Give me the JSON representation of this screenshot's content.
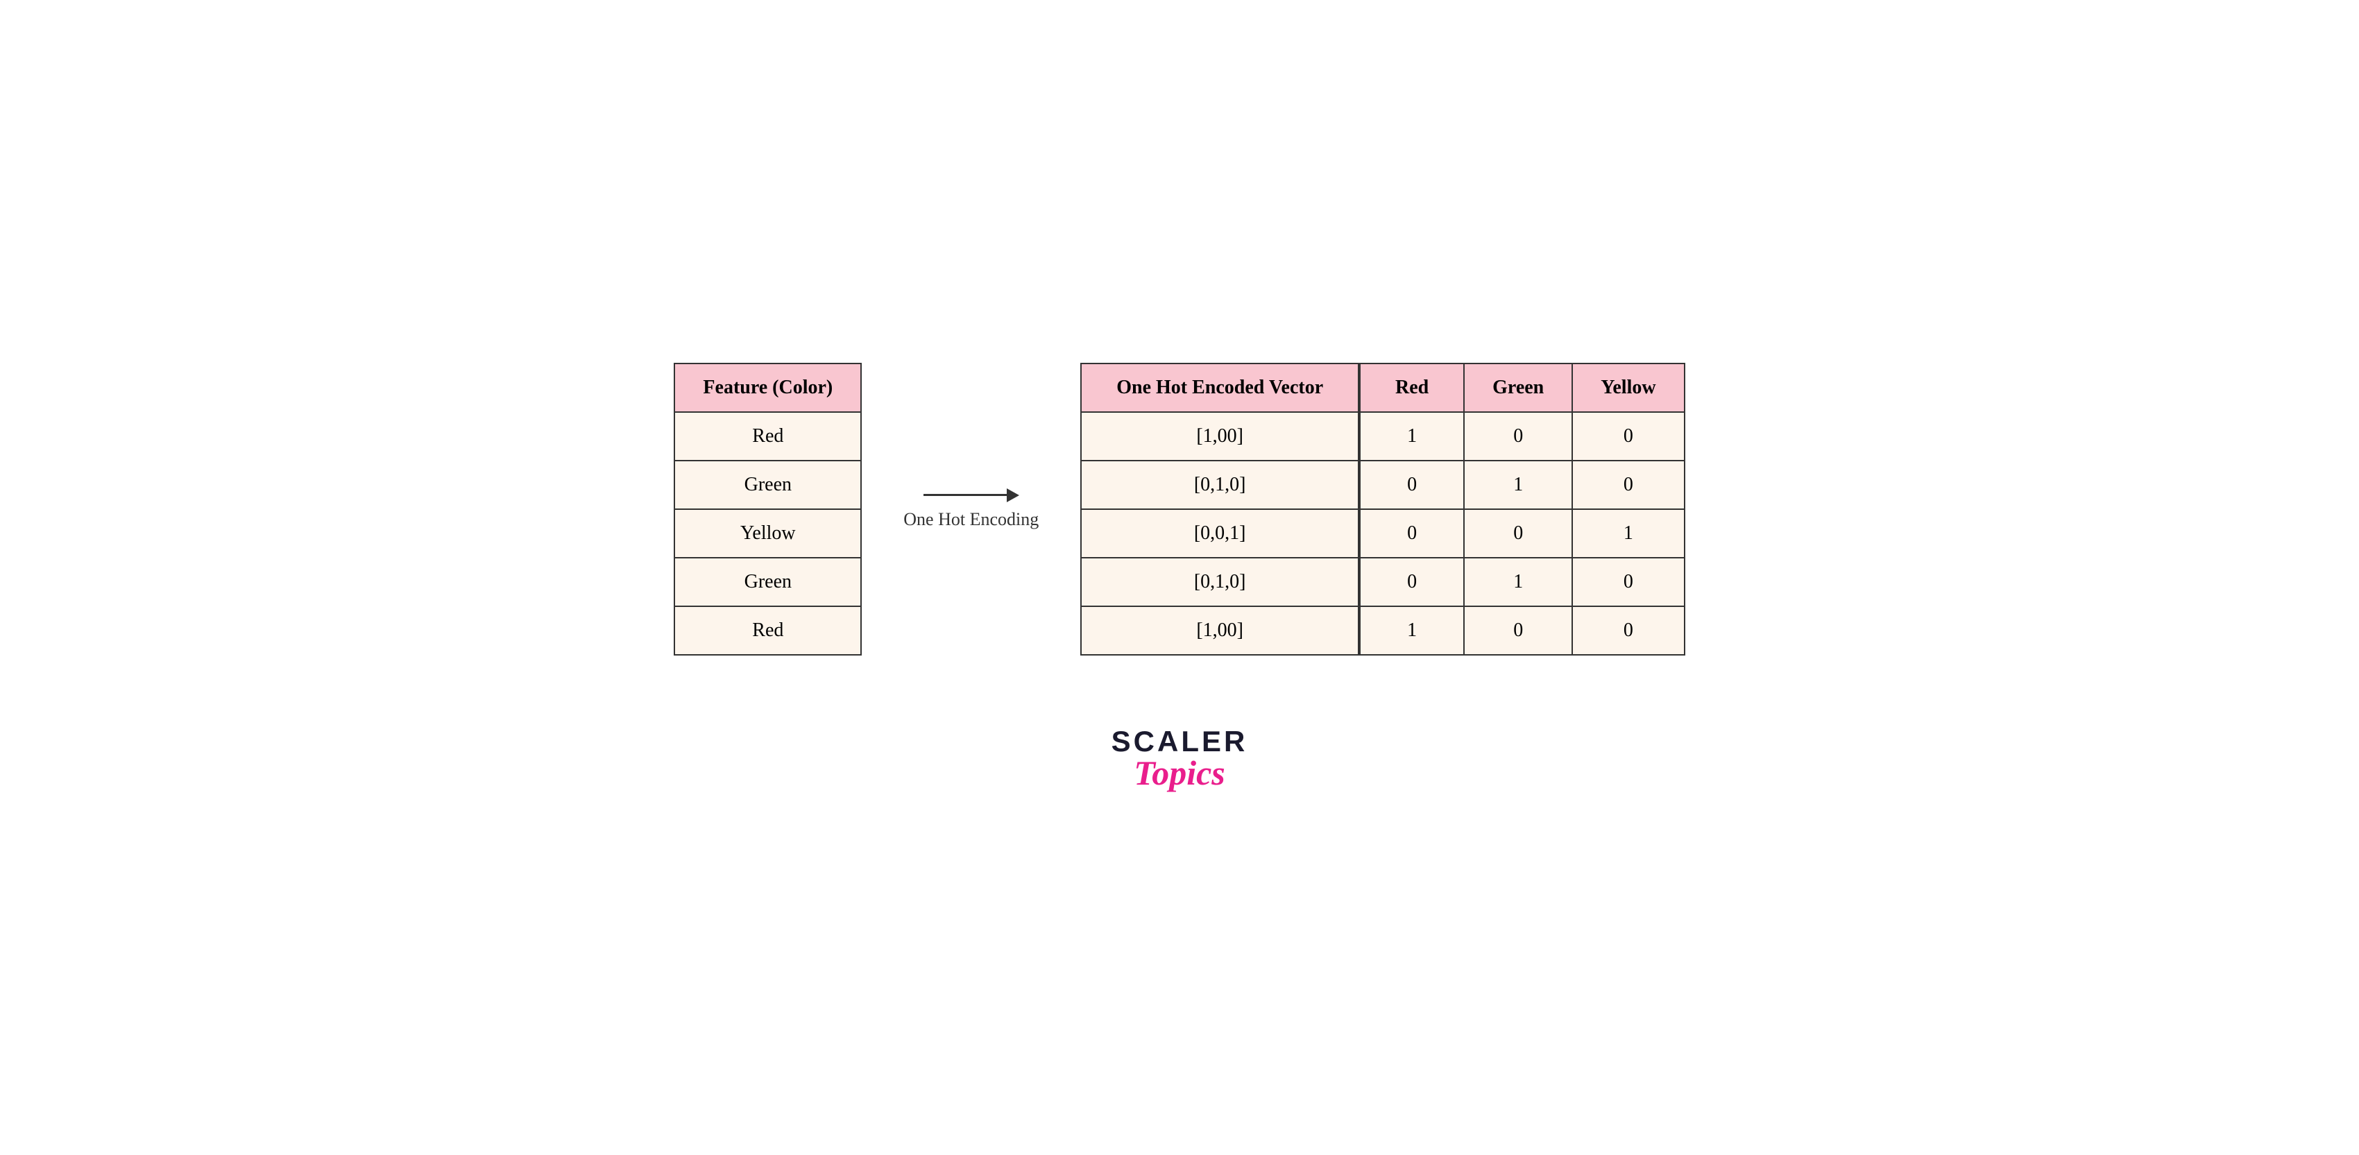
{
  "left_table": {
    "header": "Feature (Color)",
    "rows": [
      "Red",
      "Green",
      "Yellow",
      "Green",
      "Red"
    ]
  },
  "arrow": {
    "label": "One Hot Encoding"
  },
  "encoded_table": {
    "header": "One Hot Encoded Vector",
    "rows": [
      "[1,00]",
      "[0,1,0]",
      "[0,0,1]",
      "[0,1,0]",
      "[1,00]"
    ]
  },
  "split_table": {
    "headers": [
      "Red",
      "Green",
      "Yellow"
    ],
    "rows": [
      [
        "1",
        "0",
        "0"
      ],
      [
        "0",
        "1",
        "0"
      ],
      [
        "0",
        "0",
        "1"
      ],
      [
        "0",
        "1",
        "0"
      ],
      [
        "1",
        "0",
        "0"
      ]
    ]
  },
  "branding": {
    "scaler": "SCALER",
    "topics": "Topics"
  }
}
